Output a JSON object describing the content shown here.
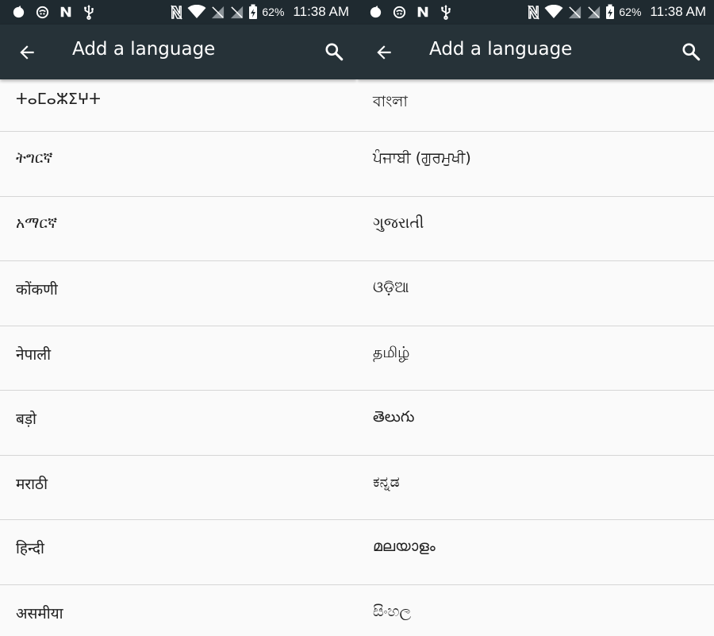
{
  "status_bar": {
    "battery_percent": "62%",
    "time": "11:38 AM",
    "icons": [
      "notification-icon",
      "app-notification-icon",
      "n-icon",
      "usb-icon",
      "nfc-icon",
      "wifi-icon",
      "no-signal-icon",
      "no-signal-icon",
      "battery-charging-icon"
    ]
  },
  "left_screen": {
    "title": "Add a language",
    "languages": [
      "ⵜⴰⵎⴰⵣⵉⵖⵜ",
      "ትግርኛ",
      "አማርኛ",
      "कोंकणी",
      "नेपाली",
      "बड़ो",
      "मराठी",
      "हिन्दी",
      "असमीया"
    ]
  },
  "right_screen": {
    "title": "Add a language",
    "languages": [
      "বাংলা",
      "ਪੰਜਾਬੀ (ਗੁਰਮੁਖੀ)",
      "ગુજરાતી",
      "ଓଡ଼ିଆ",
      "தமிழ்",
      "తెలుగు",
      "ಕನ್ನಡ",
      "മലയാളം",
      "සිංහල"
    ]
  },
  "colors": {
    "status_bar": "#1f2a30",
    "app_bar": "#263238",
    "background": "#fafafa",
    "divider": "#d6d6d6",
    "text_primary": "#212121"
  }
}
